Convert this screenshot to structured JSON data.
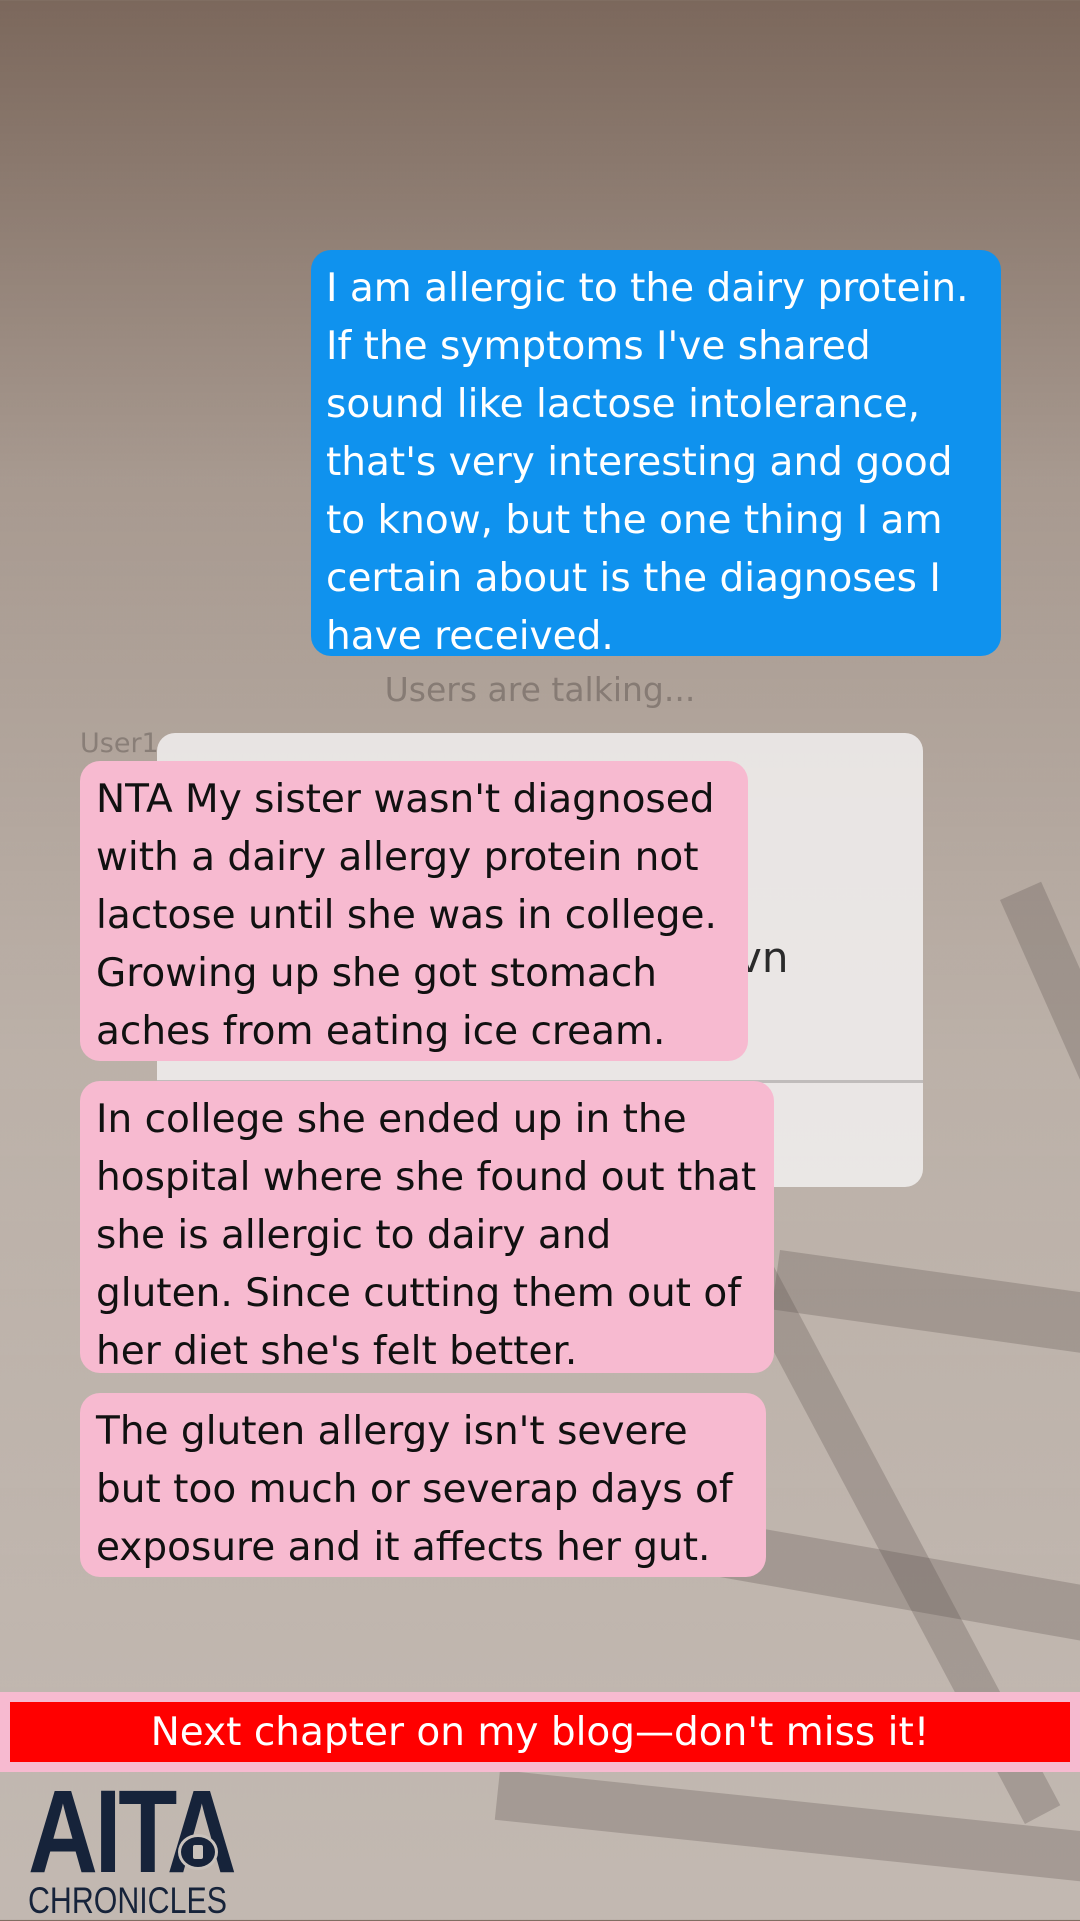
{
  "story": {
    "op_message": "I am allergic to the dairy protein. If the symptoms I've shared sound like lactose intolerance, that's very interesting and good to know, but the one thing I am certain about is the diagnoses I have received.",
    "typing_indicator": "Users are talking...",
    "username": "User1",
    "ghost_card_text": "vn",
    "replies": [
      "NTA My sister wasn't diagnosed with a dairy allergy protein not lactose until she was in college. Growing up she got stomach aches from eating ice cream.",
      "In college she ended up in the hospital where she found out that she is allergic to dairy and gluten. Since cutting them out of her diet she's felt better.",
      "The gluten allergy isn't severe but too much or severap days of exposure and it affects her gut."
    ]
  },
  "banner": {
    "text": "Next chapter on my blog—don't miss it!"
  },
  "logo": {
    "line1": "AITA",
    "line2": "CHRONICLES"
  },
  "colors": {
    "op_bubble": "#0f92ee",
    "reply_bubble": "#f7bad0",
    "banner": "#ff0000",
    "logo": "#16233a"
  }
}
